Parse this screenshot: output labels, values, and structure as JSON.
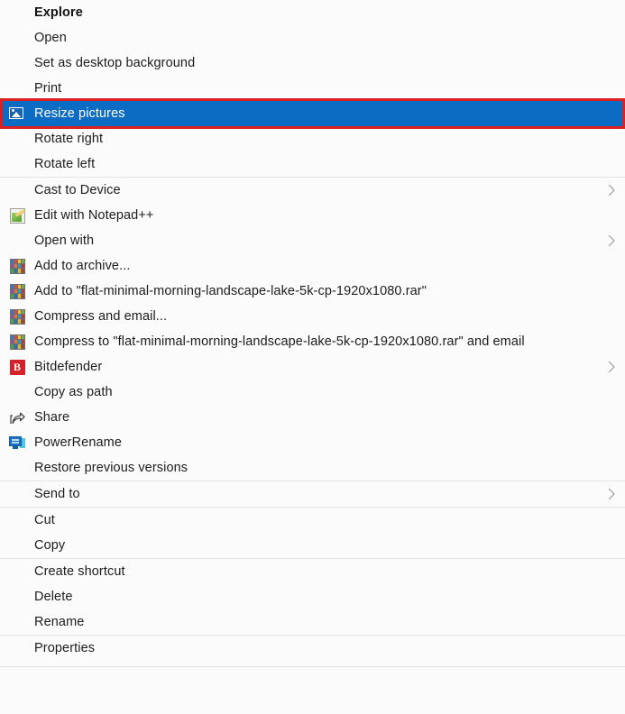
{
  "menu": {
    "type": "windows-explorer-context-menu",
    "accent_highlight_color": "#0c6cc4",
    "annotation_box_color": "#dc2020",
    "background_color": "#fbfbfb",
    "separator_color": "#e4e4e4",
    "groups": [
      {
        "id": "group-open",
        "items": [
          {
            "label": "Explore",
            "bold": true,
            "icon": "none",
            "submenu": false,
            "highlighted": false
          },
          {
            "label": "Open",
            "bold": false,
            "icon": "none",
            "submenu": false,
            "highlighted": false
          },
          {
            "label": "Set as desktop background",
            "bold": false,
            "icon": "none",
            "submenu": false,
            "highlighted": false
          },
          {
            "label": "Print",
            "bold": false,
            "icon": "none",
            "submenu": false,
            "highlighted": false
          },
          {
            "label": "Resize pictures",
            "bold": false,
            "icon": "resize-pictures-icon",
            "submenu": false,
            "highlighted": true
          },
          {
            "label": "Rotate right",
            "bold": false,
            "icon": "none",
            "submenu": false,
            "highlighted": false
          },
          {
            "label": "Rotate left",
            "bold": false,
            "icon": "none",
            "submenu": false,
            "highlighted": false
          }
        ]
      },
      {
        "id": "group-apps",
        "items": [
          {
            "label": "Cast to Device",
            "bold": false,
            "icon": "none",
            "submenu": true,
            "highlighted": false
          },
          {
            "label": "Edit with Notepad++",
            "bold": false,
            "icon": "notepad-plus-plus-icon",
            "submenu": false,
            "highlighted": false
          },
          {
            "label": "Open with",
            "bold": false,
            "icon": "none",
            "submenu": true,
            "highlighted": false
          },
          {
            "label": "Add to archive...",
            "bold": false,
            "icon": "winrar-icon",
            "submenu": false,
            "highlighted": false
          },
          {
            "label": "Add to \"flat-minimal-morning-landscape-lake-5k-cp-1920x1080.rar\"",
            "bold": false,
            "icon": "winrar-icon",
            "submenu": false,
            "highlighted": false
          },
          {
            "label": "Compress and email...",
            "bold": false,
            "icon": "winrar-icon",
            "submenu": false,
            "highlighted": false
          },
          {
            "label": "Compress to \"flat-minimal-morning-landscape-lake-5k-cp-1920x1080.rar\" and email",
            "bold": false,
            "icon": "winrar-icon",
            "submenu": false,
            "highlighted": false
          },
          {
            "label": "Bitdefender",
            "bold": false,
            "icon": "bitdefender-icon",
            "submenu": true,
            "highlighted": false
          },
          {
            "label": "Copy as path",
            "bold": false,
            "icon": "none",
            "submenu": false,
            "highlighted": false
          },
          {
            "label": "Share",
            "bold": false,
            "icon": "share-icon",
            "submenu": false,
            "highlighted": false
          },
          {
            "label": "PowerRename",
            "bold": false,
            "icon": "powerrename-icon",
            "submenu": false,
            "highlighted": false
          },
          {
            "label": "Restore previous versions",
            "bold": false,
            "icon": "none",
            "submenu": false,
            "highlighted": false
          }
        ]
      },
      {
        "id": "group-sendto",
        "items": [
          {
            "label": "Send to",
            "bold": false,
            "icon": "none",
            "submenu": true,
            "highlighted": false
          }
        ]
      },
      {
        "id": "group-clipboard",
        "items": [
          {
            "label": "Cut",
            "bold": false,
            "icon": "none",
            "submenu": false,
            "highlighted": false
          },
          {
            "label": "Copy",
            "bold": false,
            "icon": "none",
            "submenu": false,
            "highlighted": false
          }
        ]
      },
      {
        "id": "group-file",
        "items": [
          {
            "label": "Create shortcut",
            "bold": false,
            "icon": "none",
            "submenu": false,
            "highlighted": false
          },
          {
            "label": "Delete",
            "bold": false,
            "icon": "none",
            "submenu": false,
            "highlighted": false
          },
          {
            "label": "Rename",
            "bold": false,
            "icon": "none",
            "submenu": false,
            "highlighted": false
          }
        ]
      },
      {
        "id": "group-properties",
        "items": [
          {
            "label": "Properties",
            "bold": false,
            "icon": "none",
            "submenu": false,
            "highlighted": false
          }
        ]
      }
    ]
  }
}
